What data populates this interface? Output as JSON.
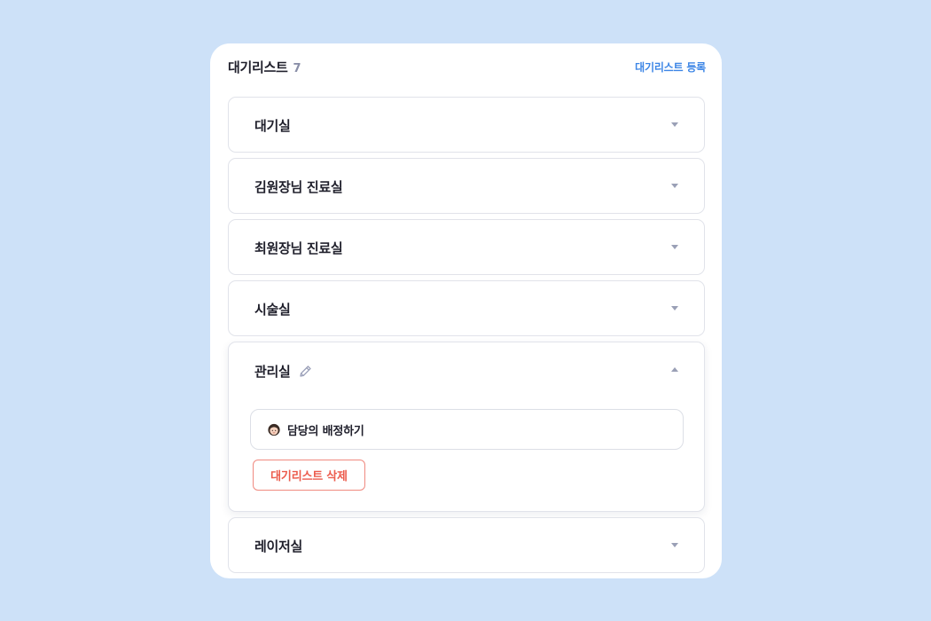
{
  "header": {
    "title": "대기리스트",
    "count": "7",
    "register_label": "대기리스트 등록"
  },
  "rooms": [
    {
      "name": "대기실",
      "expanded": false
    },
    {
      "name": "김원장님 진료실",
      "expanded": false
    },
    {
      "name": "최원장님 진료실",
      "expanded": false
    },
    {
      "name": "시술실",
      "expanded": false
    },
    {
      "name": "관리실",
      "expanded": true
    },
    {
      "name": "레이저실",
      "expanded": false
    }
  ],
  "expanded_room": {
    "assign_label": "담당의 배정하기",
    "delete_label": "대기리스트 삭제"
  },
  "icons": {
    "caret": "chevron-down-icon",
    "edit": "pencil-icon",
    "avatar": "doctor-avatar-icon"
  },
  "colors": {
    "background": "#cde1f8",
    "accent": "#3d86e6",
    "danger": "#ec5b4c"
  }
}
